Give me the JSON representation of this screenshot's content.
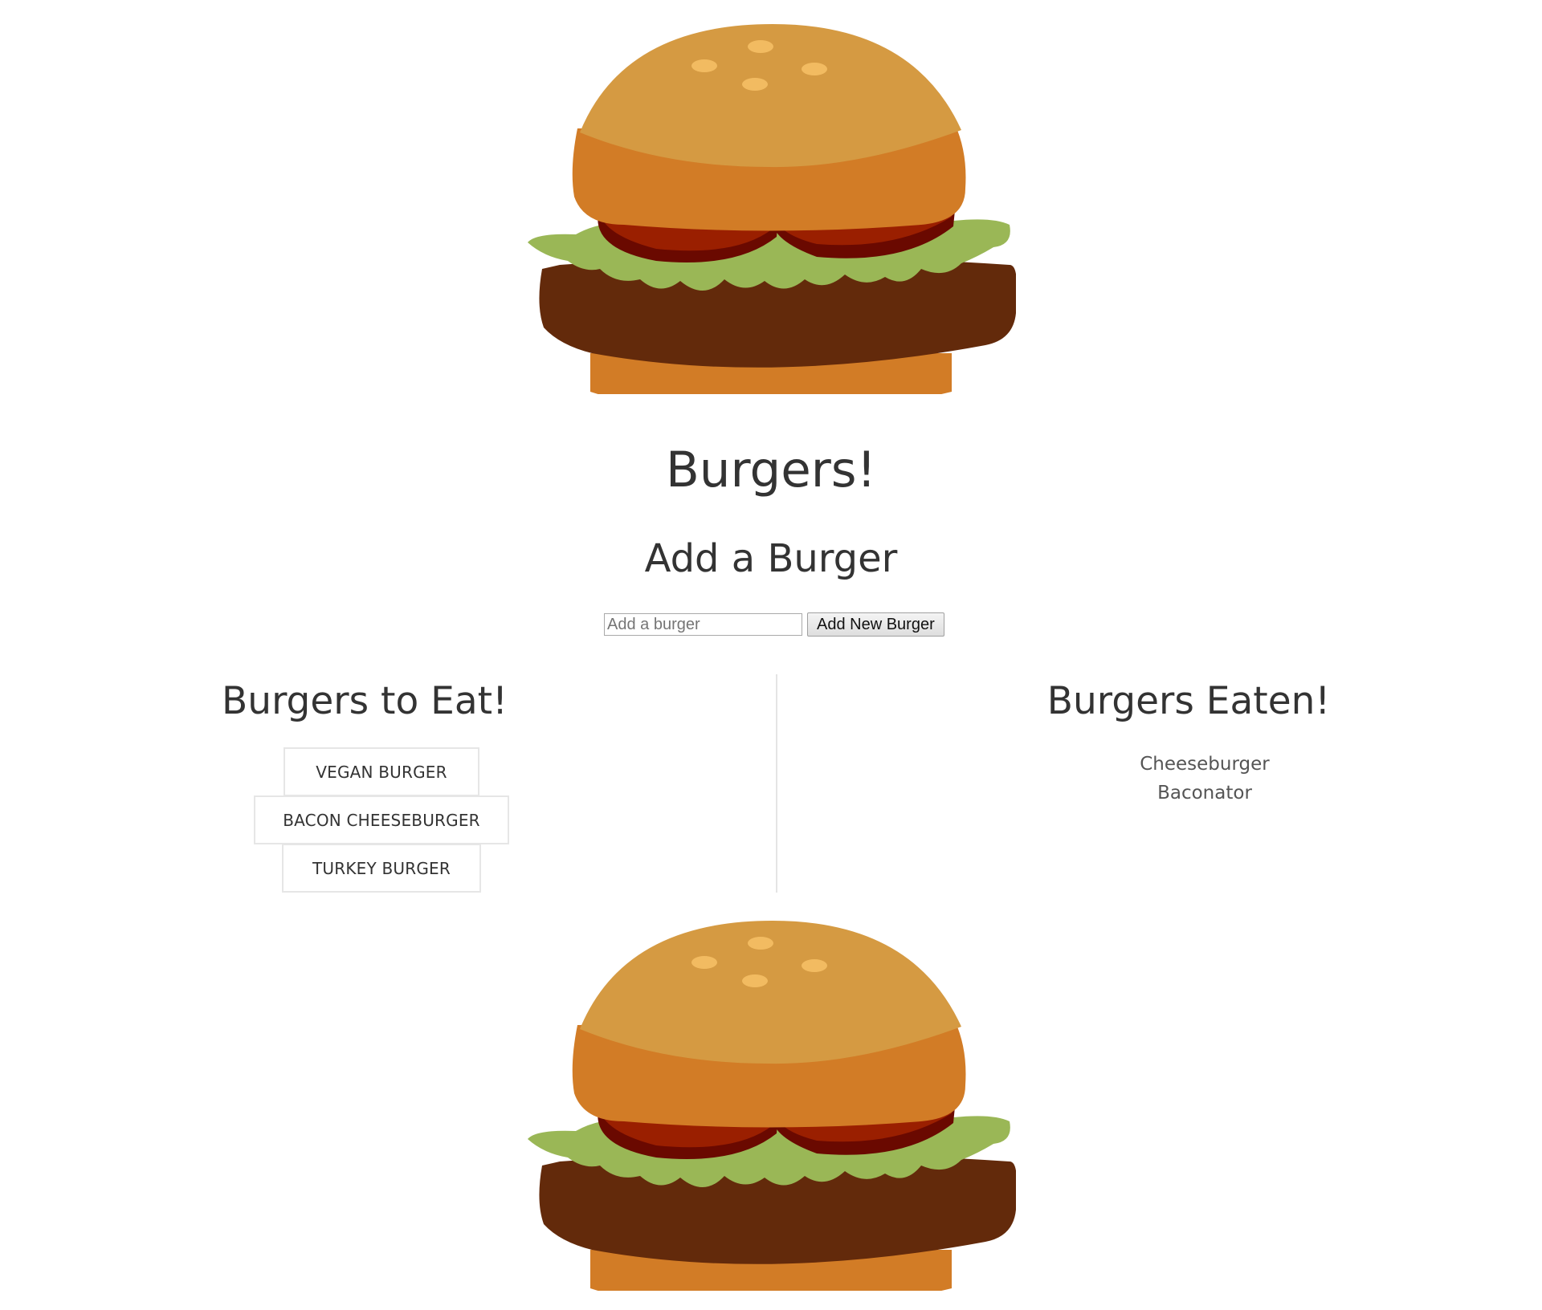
{
  "header": {
    "title": "Burgers!"
  },
  "add_section": {
    "heading": "Add a Burger",
    "input_placeholder": "Add a burger",
    "input_value": "",
    "button_label": "Add New Burger"
  },
  "to_eat": {
    "heading": "Burgers to Eat!",
    "items": [
      "VEGAN BURGER",
      "BACON CHEESEBURGER",
      "TURKEY BURGER"
    ]
  },
  "eaten": {
    "heading": "Burgers Eaten!",
    "items": [
      "Cheeseburger",
      "Baconator"
    ]
  },
  "icons": {
    "top_image": "burger-illustration",
    "bottom_image": "burger-illustration"
  },
  "colors": {
    "bun_top": "#D59A42",
    "bun_mid": "#D27C26",
    "tomato": "#9A1F00",
    "tomato_edge": "#6A0900",
    "lettuce": "#9AB756",
    "patty": "#632A0B",
    "seed": "#F2BB61"
  }
}
